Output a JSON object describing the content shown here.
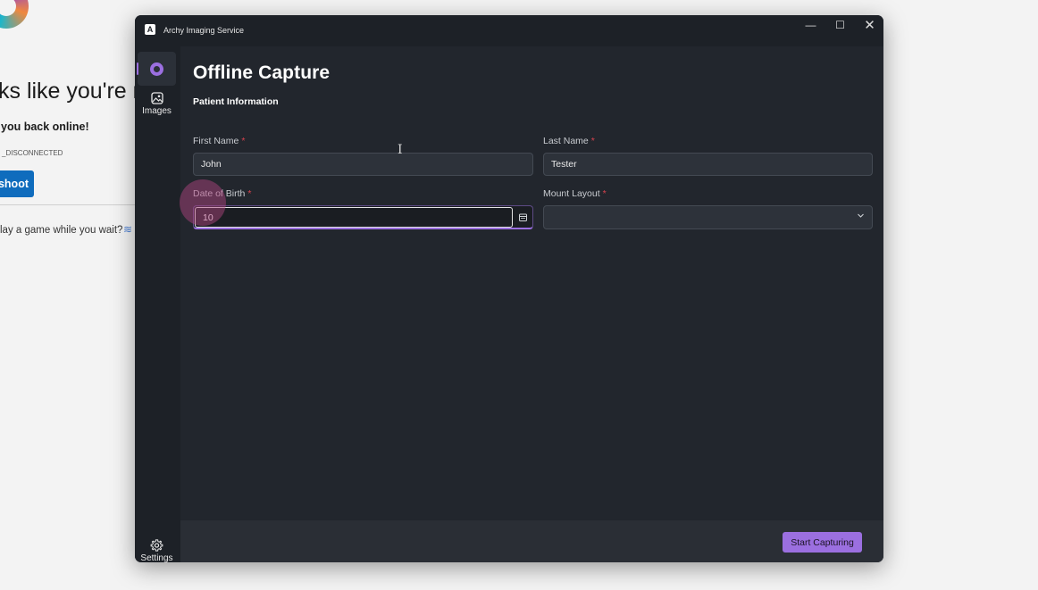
{
  "background_page": {
    "heading": "ks like you're n",
    "subheading": "you back online!",
    "error_code": "_DISCONNECTED",
    "button_label": "shoot",
    "game_prompt": "lay a game while you wait?",
    "game_icon": "≋"
  },
  "window": {
    "title": "Archy Imaging Service",
    "logo_letter": "A",
    "controls": {
      "minimize": "—",
      "maximize": "☐",
      "close": "✕"
    }
  },
  "sidebar": {
    "images_label": "Images",
    "settings_label": "Settings",
    "images_icon": "image-icon",
    "settings_icon": "gear-icon"
  },
  "form": {
    "page_title": "Offline Capture",
    "section_title": "Patient Information",
    "first_name": {
      "label": "First Name",
      "required": "*",
      "value": "John"
    },
    "last_name": {
      "label": "Last Name",
      "required": "*",
      "value": "Tester"
    },
    "dob": {
      "label": "Date of Birth",
      "required": "*",
      "value": "10"
    },
    "mount_layout": {
      "label": "Mount Layout",
      "required": "*",
      "value": ""
    }
  },
  "footer": {
    "start_label": "Start Capturing"
  },
  "colors": {
    "accent": "#9b6fe0",
    "required": "#d9434e",
    "window_bg": "#22262d",
    "sidebar_bg": "#1d2127"
  }
}
